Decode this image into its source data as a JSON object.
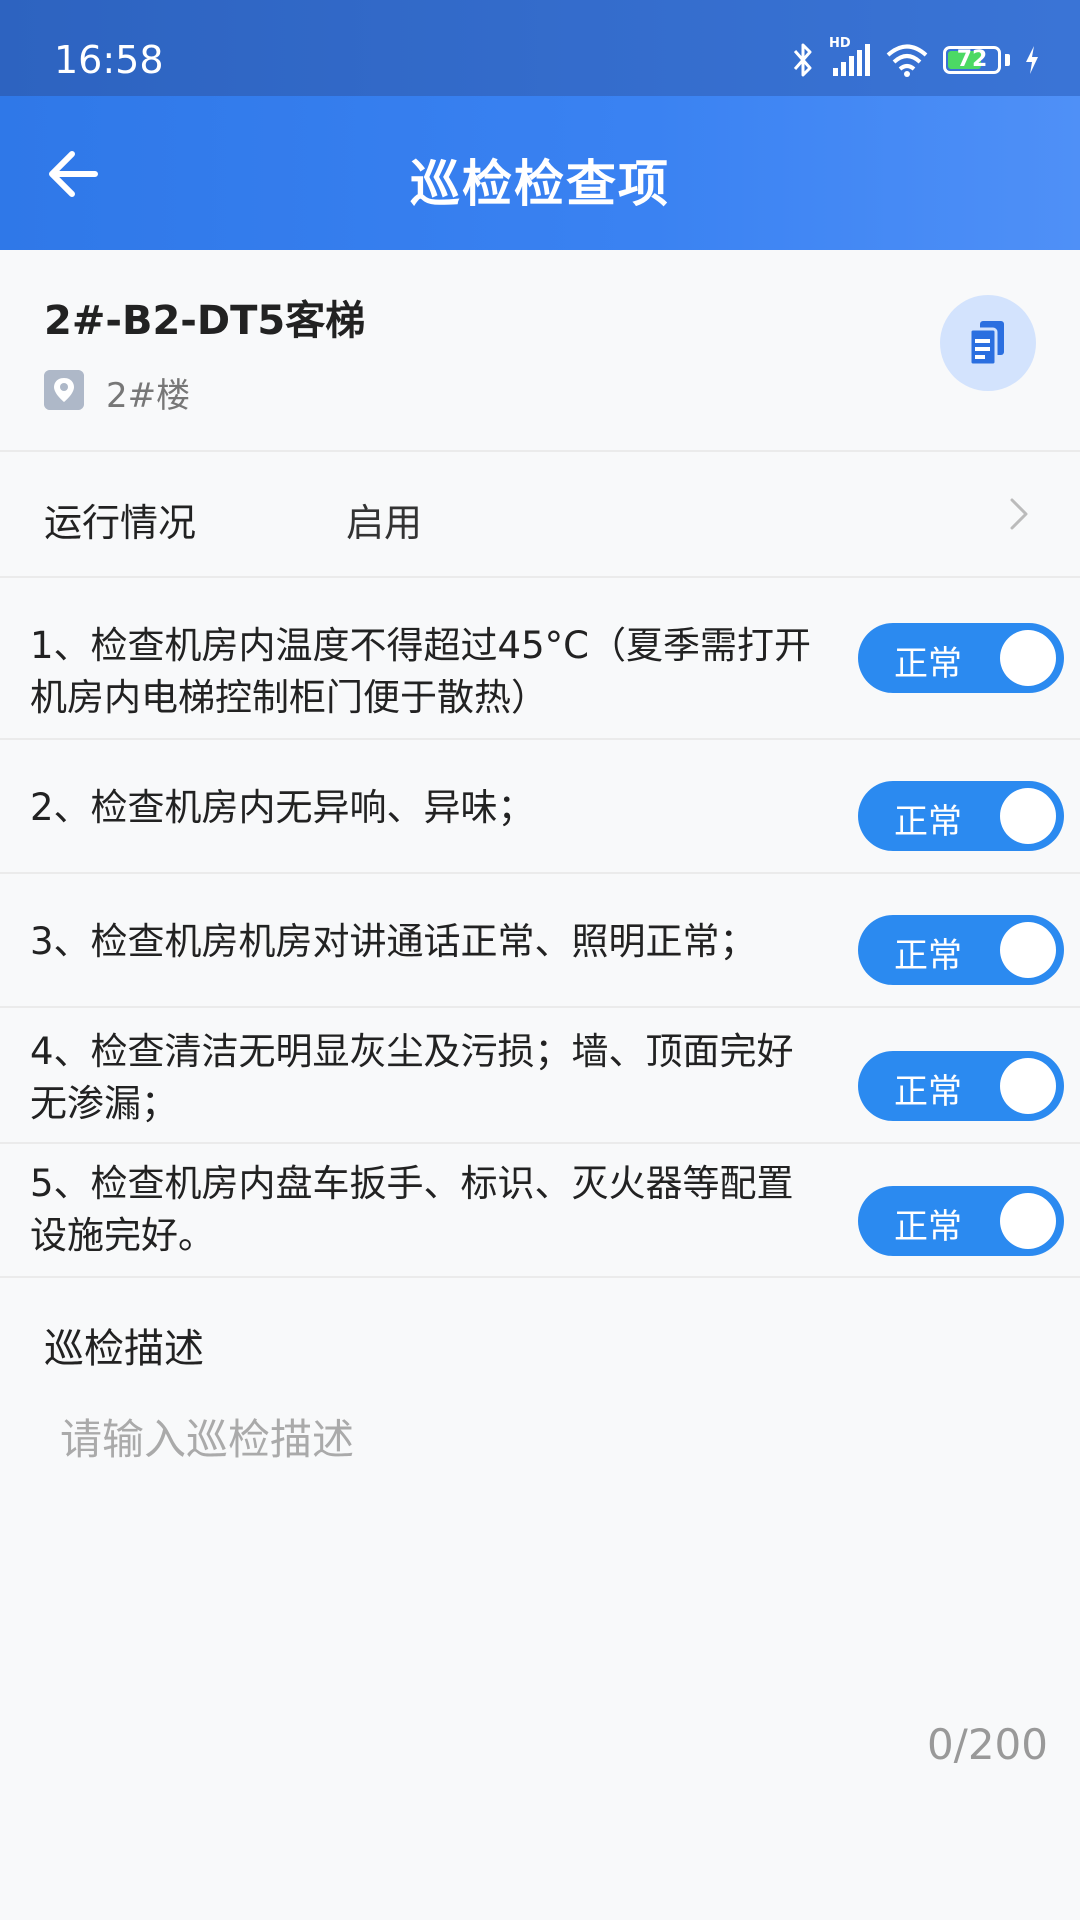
{
  "status_bar": {
    "time": "16:58",
    "battery": "72",
    "battery_level": 0.72,
    "network": "HD"
  },
  "header": {
    "title": "巡检检查项"
  },
  "device": {
    "name": "2#-B2-DT5客梯",
    "location": "2#楼"
  },
  "run_status": {
    "label": "运行情况",
    "value": "启用"
  },
  "items": [
    {
      "text": "1、检查机房内温度不得超过45°C（夏季需打开机房内电梯控制柜门便于散热）",
      "toggle": "正常",
      "on": true
    },
    {
      "text": "2、检查机房内无异响、异味；",
      "toggle": "正常",
      "on": true
    },
    {
      "text": "3、检查机房机房对讲通话正常、照明正常；",
      "toggle": "正常",
      "on": true
    },
    {
      "text": "4、检查清洁无明显灰尘及污损；墙、顶面完好无渗漏；",
      "toggle": "正常",
      "on": true
    },
    {
      "text": "5、检查机房内盘车扳手、标识、灭火器等配置设施完好。",
      "toggle": "正常",
      "on": true
    }
  ],
  "description": {
    "title": "巡检描述",
    "placeholder": "请输入巡检描述",
    "value": "",
    "counter": "0/200"
  },
  "colors": {
    "header": "#3a82f2",
    "toggle_on": "#2b8af0",
    "doc_button_bg": "#d3e3fd"
  },
  "icons": {
    "back": "arrow-left-icon",
    "location": "location-pin-icon",
    "document": "document-copy-icon",
    "chevron": "chevron-right-icon"
  }
}
